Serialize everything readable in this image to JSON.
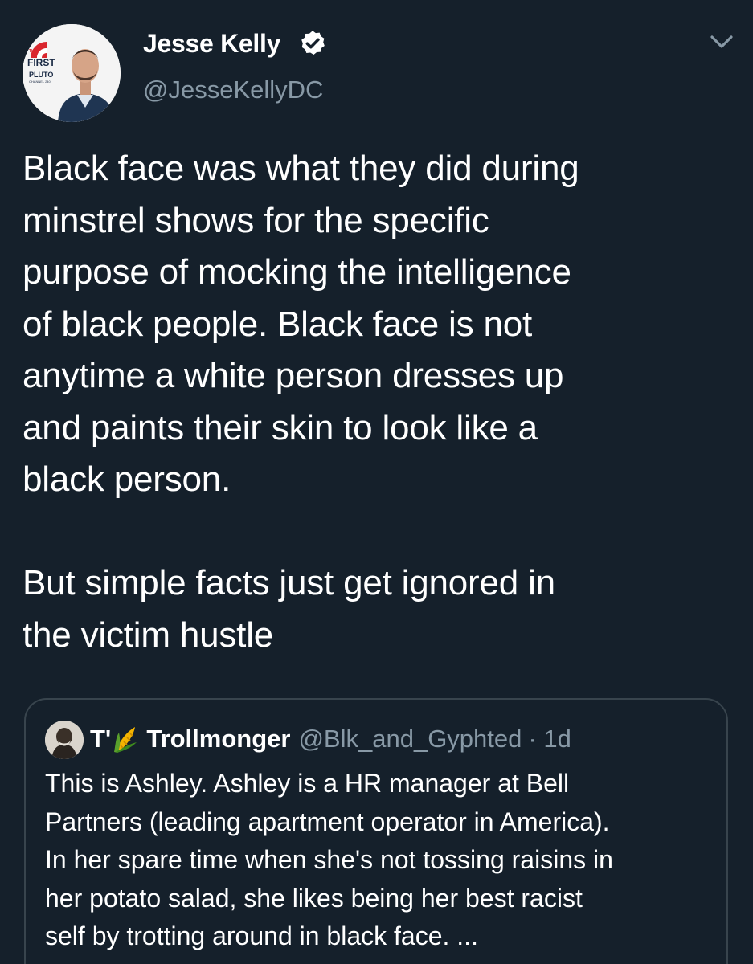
{
  "author": {
    "name": "Jesse Kelly",
    "handle": "@JesseKellyDC",
    "verified": true,
    "avatar_logo_text": [
      "THE",
      "FIRST",
      "PLUTO",
      "CHANNEL 240"
    ]
  },
  "tweet": {
    "lines": [
      "Black face was what they did during",
      "minstrel shows for the specific",
      "purpose of mocking the intelligence",
      "of black people. Black face is not",
      "anytime a white person dresses up",
      "and paints their skin to look like a",
      "black person.",
      "",
      "But simple facts just get ignored in",
      "the victim hustle"
    ]
  },
  "quoted_tweet": {
    "name_prefix": "T'",
    "name": "Trollmonger",
    "handle": "@Blk_and_Gyphted",
    "time": "· 1d",
    "lines": [
      "This is Ashley. Ashley is a HR manager at Bell",
      "Partners (leading apartment operator in America).",
      "In her spare time when she's not tossing raisins in",
      "her potato salad, she likes being her best racist",
      "self by trotting around in black face.  ..."
    ]
  },
  "icons": {
    "verified": "verified-badge-icon",
    "caret": "chevron-down-icon",
    "emoji": "corn-emoji-icon"
  },
  "colors": {
    "background": "#15202b",
    "text": "#ffffff",
    "secondary_text": "#8899a6",
    "border": "#38444d",
    "logo_red": "#d9262e"
  }
}
